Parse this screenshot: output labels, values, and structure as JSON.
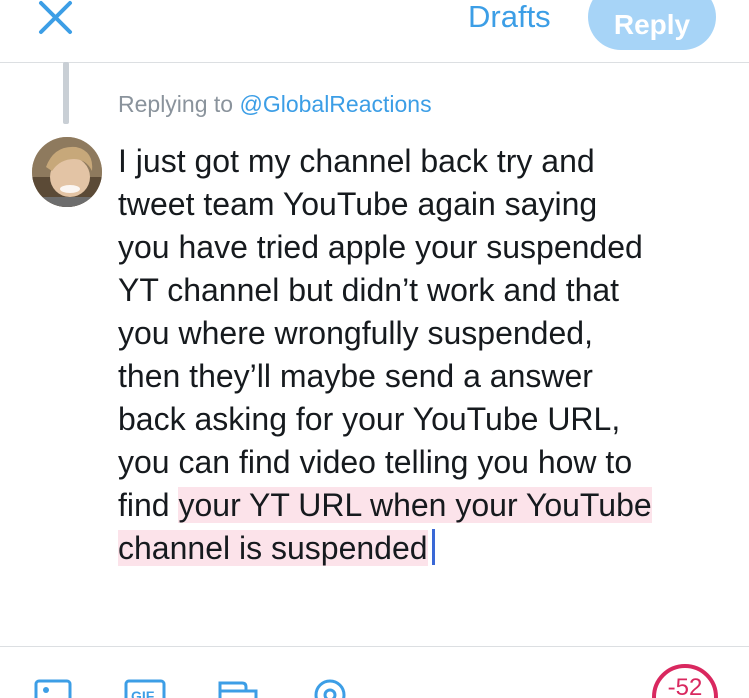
{
  "header": {
    "close_icon": "close-icon",
    "drafts_label": "Drafts",
    "reply_label": "Reply"
  },
  "reply_context": {
    "prefix": "Replying to",
    "handle": "@GlobalReactions"
  },
  "compose": {
    "lines": [
      "I just got my channel back try and",
      "tweet team YouTube again saying",
      "you have tried apple your suspended",
      "YT channel but didn’t work and that",
      "you where wrongfully suspended,",
      "then they’ll maybe send a answer",
      "back asking for your YouTube URL,",
      "you can find video telling you how to"
    ],
    "line9_plain": "find",
    "line9_highlight": "your YT URL when your YouTube",
    "line10_highlight": "channel is suspended"
  },
  "toolbar": {
    "icons": [
      "image-icon",
      "gif-icon",
      "poll-icon",
      "location-icon"
    ],
    "char_count": "-52"
  },
  "colors": {
    "accent": "#3c9ee6",
    "reply_button_disabled": "#a7d4f7",
    "highlight": "#fce3ea",
    "over_limit": "#d9285f",
    "caret": "#3a68d6"
  }
}
